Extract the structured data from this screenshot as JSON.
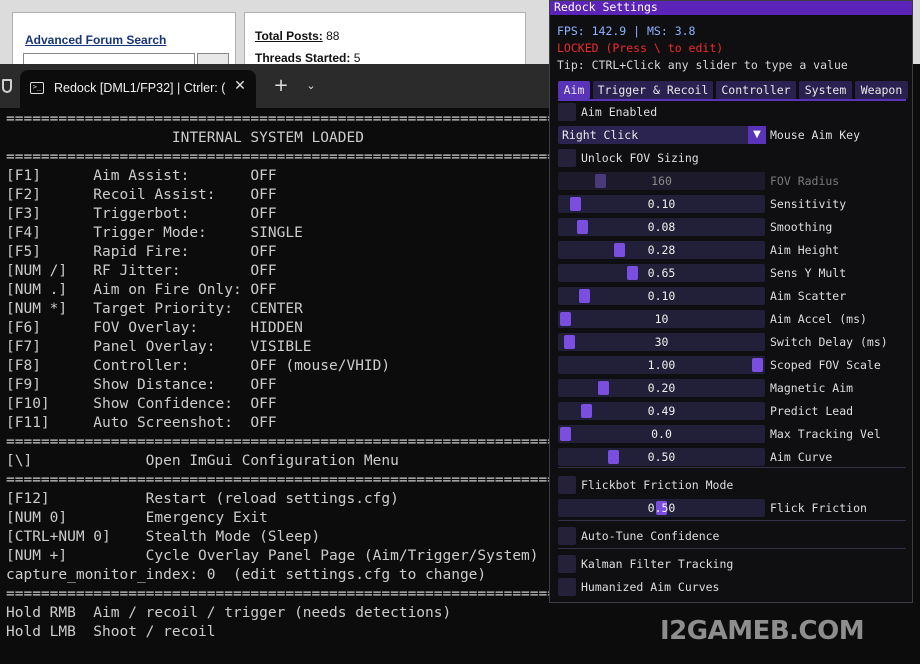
{
  "forum": {
    "advanced_search": "Advanced Forum Search",
    "total_posts_label": "Total Posts:",
    "total_posts_value": "88",
    "threads_started_label": "Threads Started:",
    "threads_started_value": "5"
  },
  "terminal": {
    "tab_title": "Redock [DML1/FP32] | Ctrler: (",
    "lines": [
      "======================================================================",
      "                   INTERNAL SYSTEM LOADED",
      "======================================================================",
      "[F1]      Aim Assist:       OFF",
      "[F2]      Recoil Assist:    OFF",
      "[F3]      Triggerbot:       OFF",
      "[F4]      Trigger Mode:     SINGLE",
      "[F5]      Rapid Fire:       OFF",
      "[NUM /]   RF Jitter:        OFF",
      "[NUM .]   Aim on Fire Only: OFF",
      "[NUM *]   Target Priority:  CENTER",
      "[F6]      FOV Overlay:      HIDDEN",
      "[F7]      Panel Overlay:    VISIBLE",
      "[F8]      Controller:       OFF (mouse/VHID)",
      "[F9]      Show Distance:    OFF",
      "[F10]     Show Confidence:  OFF",
      "[F11]     Auto Screenshot:  OFF",
      "======================================================================",
      "[\\]             Open ImGui Configuration Menu",
      "======================================================================",
      "[F12]           Restart (reload settings.cfg)",
      "[NUM 0]         Emergency Exit",
      "[CTRL+NUM 0]    Stealth Mode (Sleep)",
      "[NUM +]         Cycle Overlay Panel Page (Aim/Trigger/System)",
      "capture_monitor_index: 0  (edit settings.cfg to change)",
      "======================================================================",
      "Hold RMB  Aim / recoil / trigger (needs detections)",
      "Hold LMB  Shoot / recoil"
    ]
  },
  "panel": {
    "title": "Redock Settings",
    "fps": "FPS: 142.9 | MS: 3.8",
    "locked": "LOCKED (Press \\ to edit)",
    "tip": "Tip: CTRL+Click any slider to type a value",
    "tabs": [
      "Aim",
      "Trigger & Recoil",
      "Controller",
      "System",
      "Weapon"
    ],
    "aim_enabled": "Aim Enabled",
    "mouse_aim_key_value": "Right Click",
    "mouse_aim_key_label": "Mouse Aim Key",
    "unlock_fov": "Unlock FOV Sizing",
    "sliders": [
      {
        "label": "FOV Radius",
        "value": "160",
        "fill": 0.18,
        "disabled": true
      },
      {
        "label": "Sensitivity",
        "value": "0.10",
        "fill": 0.05
      },
      {
        "label": "Smoothing",
        "value": "0.08",
        "fill": 0.09
      },
      {
        "label": "Aim Height",
        "value": "0.28",
        "fill": 0.28
      },
      {
        "label": "Sens Y Mult",
        "value": "0.65",
        "fill": 0.35
      },
      {
        "label": "Aim Scatter",
        "value": "0.10",
        "fill": 0.1
      },
      {
        "label": "Aim Accel (ms)",
        "value": "10",
        "fill": 0.0
      },
      {
        "label": "Switch Delay (ms)",
        "value": "30",
        "fill": 0.02
      },
      {
        "label": "Scoped FOV Scale",
        "value": "1.00",
        "fill": 1.0
      },
      {
        "label": "Magnetic Aim",
        "value": "0.20",
        "fill": 0.2
      },
      {
        "label": "Predict Lead",
        "value": "0.49",
        "fill": 0.11
      },
      {
        "label": "Max Tracking Vel",
        "value": "0.0",
        "fill": 0.0
      },
      {
        "label": "Aim Curve",
        "value": "0.50",
        "fill": 0.25
      }
    ],
    "flickbot": "Flickbot Friction Mode",
    "flick_friction": {
      "label": "Flick Friction",
      "value": "0.50",
      "fill": 0.5
    },
    "auto_tune": "Auto-Tune Confidence",
    "kalman": "Kalman Filter Tracking",
    "humanized": "Humanized Aim Curves",
    "accent": "#5a34b8",
    "title_bg": "#5b23b8",
    "locked_color": "#f02a2a",
    "fps_color": "#8fb2ff"
  },
  "watermark": "I2GAMEB.COM"
}
